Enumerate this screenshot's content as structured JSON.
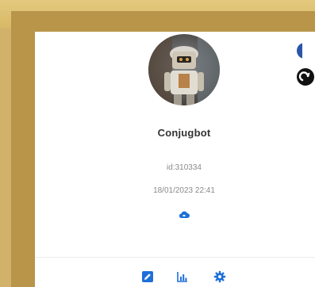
{
  "profile": {
    "name": "Conjugbot",
    "id_text": "id:310334",
    "date_text": "18/01/2023 22:41"
  },
  "icons": {
    "avatar": "robot-avatar",
    "status": "cloud-status-icon",
    "edit": "edit-icon",
    "stats": "bar-chart-icon",
    "settings": "gear-icon",
    "flag": "france-flag-icon",
    "redo": "redo-icon"
  },
  "colors": {
    "accent": "#1e6fd9",
    "frame": "#b89549",
    "background": "#c9a65a",
    "flag_blue": "#2956a8",
    "flag_red": "#e0323a"
  }
}
